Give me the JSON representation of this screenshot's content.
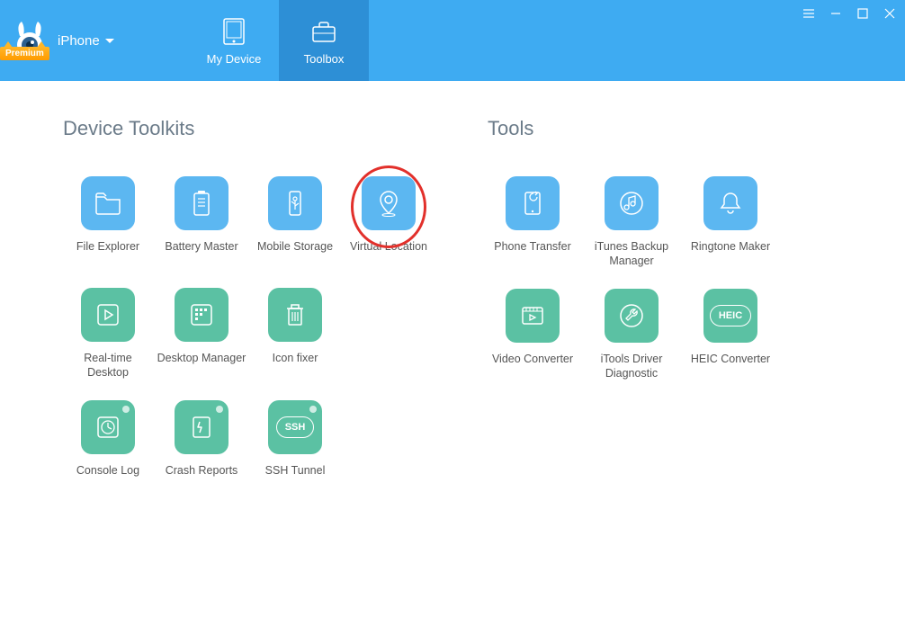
{
  "header": {
    "device_label": "iPhone",
    "premium_label": "Premium",
    "tabs": {
      "my_device": "My Device",
      "toolbox": "Toolbox"
    }
  },
  "sections": {
    "device_toolkits_title": "Device Toolkits",
    "tools_title": "Tools"
  },
  "device_toolkits": {
    "file_explorer": "File Explorer",
    "battery_master": "Battery Master",
    "mobile_storage": "Mobile Storage",
    "virtual_location": "Virtual Location",
    "realtime_desktop": "Real-time Desktop",
    "desktop_manager": "Desktop Manager",
    "icon_fixer": "Icon fixer",
    "console_log": "Console Log",
    "crash_reports": "Crash Reports",
    "ssh_tunnel": "SSH Tunnel",
    "ssh_badge": "SSH"
  },
  "tools": {
    "phone_transfer": "Phone Transfer",
    "itunes_backup_manager": "iTunes Backup Manager",
    "ringtone_maker": "Ringtone Maker",
    "video_converter": "Video Converter",
    "itools_driver_diagnostic": "iTools Driver Diagnostic",
    "heic_converter": "HEIC Converter",
    "heic_badge": "HEIC"
  }
}
